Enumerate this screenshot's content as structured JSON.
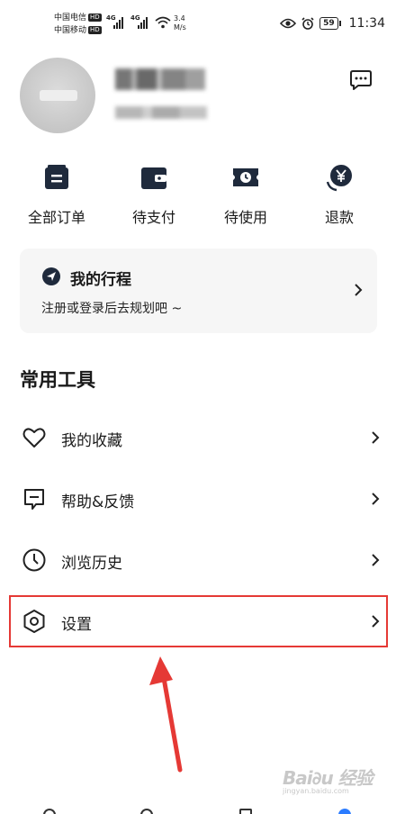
{
  "statusbar": {
    "carrier1": "中国电信",
    "carrier2": "中国移动",
    "hd": "HD",
    "net1": "4G",
    "net2": "4G",
    "speed_value": "3.4",
    "speed_unit": "M/s",
    "battery": "59",
    "time": "11:34"
  },
  "profile": {
    "message_icon": "chat-bubble-icon"
  },
  "orders": [
    {
      "label": "全部订单",
      "icon": "all-orders-icon"
    },
    {
      "label": "待支付",
      "icon": "wallet-icon"
    },
    {
      "label": "待使用",
      "icon": "ticket-clock-icon"
    },
    {
      "label": "退款",
      "icon": "refund-yen-icon"
    }
  ],
  "trip": {
    "title": "我的行程",
    "subtitle": "注册或登录后去规划吧 ~"
  },
  "tools": {
    "section_title": "常用工具",
    "items": [
      {
        "label": "我的收藏",
        "icon": "heart-icon"
      },
      {
        "label": "帮助&反馈",
        "icon": "feedback-icon"
      },
      {
        "label": "浏览历史",
        "icon": "clock-icon"
      },
      {
        "label": "设置",
        "icon": "hexagon-settings-icon"
      }
    ]
  },
  "annotation": {
    "highlight_color": "#e53935"
  },
  "watermark": {
    "brand": "Bai∂u 经验",
    "url": "jingyan.baidu.com"
  }
}
